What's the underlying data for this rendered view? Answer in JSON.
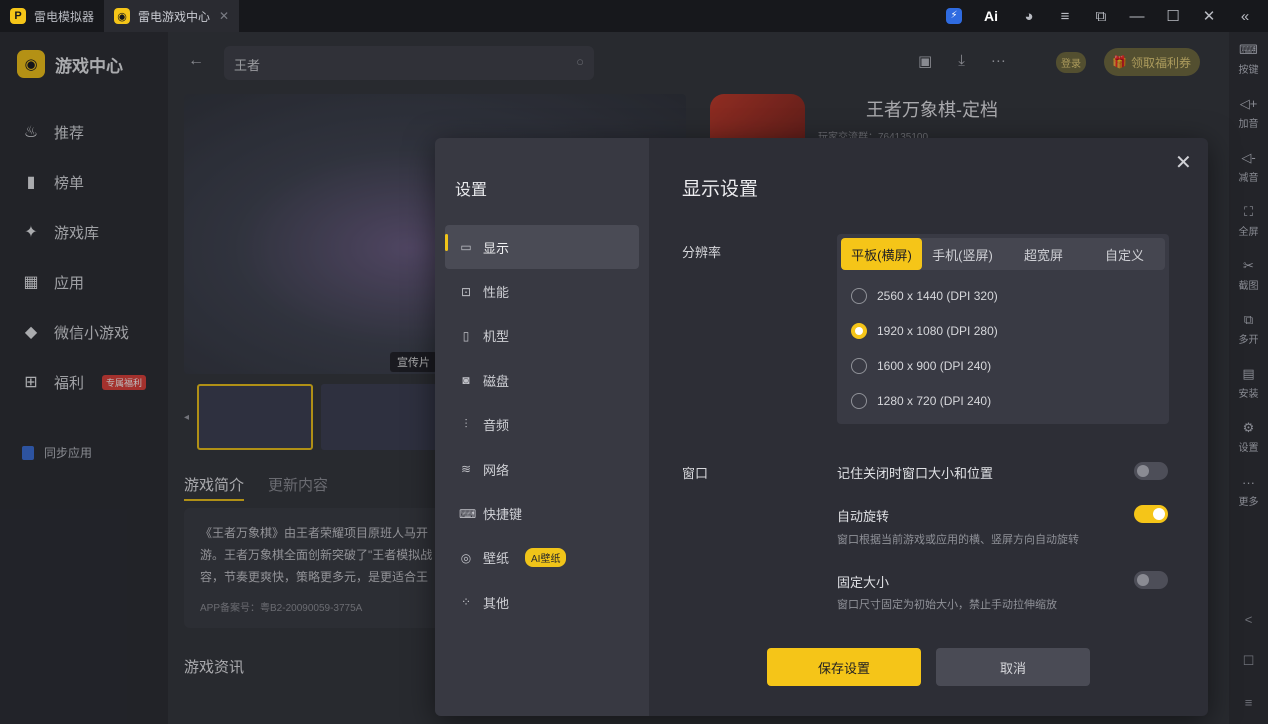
{
  "titlebar": {
    "tabs": [
      {
        "label": "雷电模拟器"
      },
      {
        "label": "雷电游戏中心"
      }
    ],
    "ai_label": "Ai"
  },
  "sidebar": {
    "brand": "游戏中心",
    "items": [
      {
        "label": "推荐",
        "icon": "flame-icon"
      },
      {
        "label": "榜单",
        "icon": "bar-chart-icon"
      },
      {
        "label": "游戏库",
        "icon": "gamepad-icon"
      },
      {
        "label": "应用",
        "icon": "apps-icon"
      },
      {
        "label": "微信小游戏",
        "icon": "mini-game-icon"
      },
      {
        "label": "福利",
        "icon": "gift-icon"
      }
    ],
    "welfare_badge": "专属福利",
    "sync": "同步应用"
  },
  "main": {
    "search_value": "王者",
    "login": "登录",
    "welfare_button": "领取福利券",
    "promo_tag": "宣传片",
    "game_title": "王者万象棋-定档",
    "game_meta": "玩家交流群：764135100",
    "tabs": [
      "游戏简介",
      "更新内容"
    ],
    "desc_lines": [
      "《王者万象棋》由王者荣耀项目原班人马开",
      "游。王者万象棋全面创新突破了\"王者模拟战",
      "容，节奏更爽快，策略更多元，是更适合王"
    ],
    "record": "APP备案号：粤B2-20090059-3775A",
    "news": "游戏资讯"
  },
  "rightbar": {
    "items": [
      {
        "label": "按键",
        "icon": "keyboard-icon"
      },
      {
        "label": "加音",
        "icon": "volume-up-icon"
      },
      {
        "label": "减音",
        "icon": "volume-down-icon"
      },
      {
        "label": "全屏",
        "icon": "fullscreen-icon"
      },
      {
        "label": "截图",
        "icon": "scissors-icon"
      },
      {
        "label": "多开",
        "icon": "multi-instance-icon"
      },
      {
        "label": "安装",
        "icon": "apk-icon"
      },
      {
        "label": "设置",
        "icon": "gear-icon"
      },
      {
        "label": "更多",
        "icon": "more-icon"
      }
    ]
  },
  "settings": {
    "title": "设置",
    "menu": [
      {
        "label": "显示",
        "icon": "monitor-icon"
      },
      {
        "label": "性能",
        "icon": "performance-icon"
      },
      {
        "label": "机型",
        "icon": "phone-icon"
      },
      {
        "label": "磁盘",
        "icon": "disk-icon"
      },
      {
        "label": "音频",
        "icon": "audio-icon"
      },
      {
        "label": "网络",
        "icon": "wifi-icon"
      },
      {
        "label": "快捷键",
        "icon": "keyboard-icon"
      },
      {
        "label": "壁纸",
        "icon": "palette-icon"
      },
      {
        "label": "其他",
        "icon": "grid-icon"
      }
    ],
    "wallpaper_badge": "AI壁纸",
    "heading": "显示设置",
    "resolution_label": "分辨率",
    "orientations": [
      "平板(横屏)",
      "手机(竖屏)",
      "超宽屏",
      "自定义"
    ],
    "selected_orientation": 0,
    "resolutions": [
      "2560 x 1440  (DPI 320)",
      "1920 x 1080  (DPI 280)",
      "1600 x 900  (DPI 240)",
      "1280 x 720  (DPI 240)"
    ],
    "selected_resolution": 1,
    "window_label": "窗口",
    "options": [
      {
        "title": "记住关闭时窗口大小和位置",
        "desc": "",
        "on": false
      },
      {
        "title": "自动旋转",
        "desc": "窗口根据当前游戏或应用的横、竖屏方向自动旋转",
        "on": true
      },
      {
        "title": "固定大小",
        "desc": "窗口尺寸固定为初始大小，禁止手动拉伸缩放",
        "on": false
      }
    ],
    "save": "保存设置",
    "cancel": "取消"
  }
}
